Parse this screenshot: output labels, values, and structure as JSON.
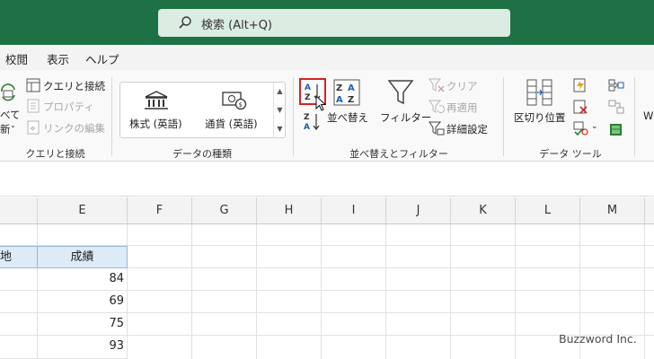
{
  "search": {
    "text": "検索 (Alt+Q)"
  },
  "menu": {
    "items": [
      "校閲",
      "表示",
      "ヘルプ"
    ]
  },
  "ribbon": {
    "query_group": {
      "label": "クエリと接続",
      "partial_label_1": "べて",
      "partial_label_2": "新",
      "items": [
        "クエリと接続",
        "プロパティ",
        "リンクの編集"
      ]
    },
    "data_types_group": {
      "label": "データの種類",
      "stocks": "株式 (英語)",
      "currencies": "通貨 (英語)"
    },
    "sort_filter_group": {
      "label": "並べ替えとフィルター",
      "sort": "並べ替え",
      "filter": "フィルター",
      "clear": "クリア",
      "reapply": "再適用",
      "advanced": "詳細設定"
    },
    "data_tools_group": {
      "label": "データ ツール",
      "text_to_columns": "区切り位置"
    },
    "partial_right": "W"
  },
  "grid": {
    "columns": [
      "",
      "E",
      "F",
      "G",
      "H",
      "I",
      "J",
      "K",
      "L",
      "M"
    ],
    "header_row": {
      "partial": "地",
      "score": "成績"
    },
    "scores": [
      "84",
      "69",
      "75",
      "93"
    ]
  },
  "watermark": "Buzzword Inc.",
  "colors": {
    "titlebar": "#1e7145",
    "highlight": "#d42323",
    "header_fill": "#ddebf7"
  }
}
